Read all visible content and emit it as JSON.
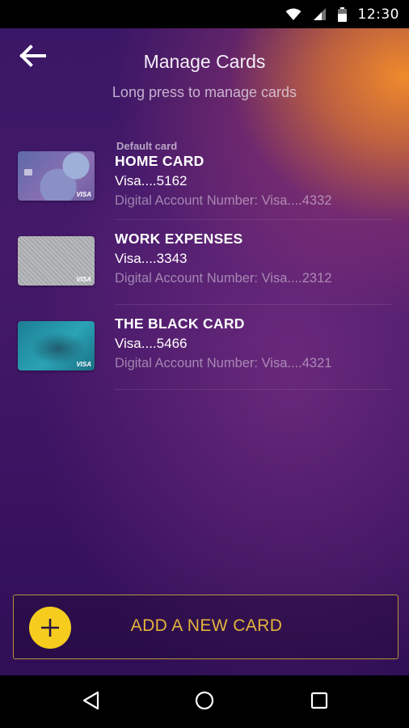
{
  "status_bar": {
    "time": "12:30"
  },
  "header": {
    "title": "Manage Cards",
    "subtitle": "Long press to manage cards"
  },
  "cards": [
    {
      "default_label": "Default card",
      "name": "HOME CARD",
      "number": "Visa....5162",
      "digital": "Digital Account Number: Visa....4332"
    },
    {
      "default_label": "",
      "name": "WORK EXPENSES",
      "number": "Visa....3343",
      "digital": "Digital Account Number: Visa....2312"
    },
    {
      "default_label": "",
      "name": "THE BLACK CARD",
      "number": "Visa....5466",
      "digital": "Digital Account Number: Visa....4321"
    }
  ],
  "add_button": {
    "label": "ADD A NEW CARD"
  },
  "thumb_text": {
    "visa": "VISA"
  },
  "colors": {
    "accent_gold": "#e4b43b",
    "plus_yellow": "#f6cd1e",
    "background_purple": "#3a1766",
    "background_orange": "#ef8a2c"
  },
  "icons": {
    "back": "arrow-left-icon",
    "wifi": "wifi-icon",
    "signal": "signal-icon",
    "battery": "battery-icon",
    "plus": "plus-icon",
    "nav_back": "triangle-back-icon",
    "nav_home": "circle-home-icon",
    "nav_recents": "square-recents-icon"
  }
}
